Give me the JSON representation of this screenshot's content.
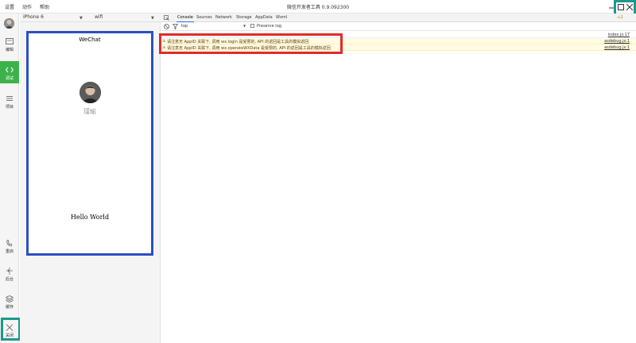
{
  "menu": {
    "settings": "设置",
    "actions": "动作",
    "help": "帮助"
  },
  "window": {
    "title": "微信开发者工具 0.9.092300"
  },
  "sidebar": {
    "items": [
      {
        "label": "编辑",
        "icon": "editor-icon"
      },
      {
        "label": "调试",
        "icon": "debug-icon"
      },
      {
        "label": "项目",
        "icon": "project-icon"
      },
      {
        "label": "重启",
        "icon": "restart-icon"
      },
      {
        "label": "后台",
        "icon": "background-icon"
      },
      {
        "label": "缓存",
        "icon": "cache-icon"
      },
      {
        "label": "关闭",
        "icon": "close-icon"
      }
    ]
  },
  "device": {
    "model": "iPhone 6",
    "network": "wifi"
  },
  "simulator": {
    "nav_title": "WeChat",
    "user_name": "瑾瑜",
    "hello_text": "Hello World"
  },
  "devtools": {
    "tabs": [
      "Console",
      "Sources",
      "Network",
      "Storage",
      "AppData",
      "Wxml"
    ],
    "active_tab": "Console",
    "context": "top",
    "preserve_log": "Preserve log",
    "warning_count": "2"
  },
  "console": {
    "lines": [
      {
        "text": "",
        "source": "index.js:17",
        "type": "log"
      },
      {
        "text": "请注意无 AppID 关联下, 调用 wx.login 是受限的, API 的返回是工具的模拟返回",
        "source": "asdebug.js:1",
        "type": "warning"
      },
      {
        "text": "请注意无 AppID 关联下, 调用 wx.operateWXData 是受限的, API 的返回是工具的模拟返回",
        "source": "asdebug.js:1",
        "type": "warning"
      }
    ]
  },
  "colors": {
    "accent_green": "#3cb34a",
    "annotation_blue": "#2c4fc4",
    "annotation_red": "#e02b2b",
    "annotation_teal": "#1b998b"
  }
}
